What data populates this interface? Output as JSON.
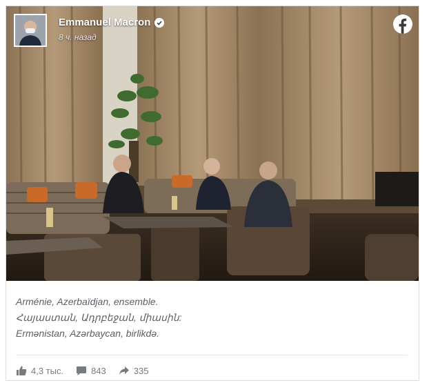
{
  "post": {
    "author": "Emmanuel Macron",
    "timestamp": "8 ч. назад",
    "caption_lines": [
      "Arménie, Azerbaïdjan, ensemble.",
      "Հայաստան, Ադրբեջան, միասին:",
      "Ermənistan, Azərbaycan, birlikdə."
    ],
    "stats": {
      "likes": "4,3 тыс.",
      "comments": "843",
      "shares": "335"
    }
  },
  "icons": {
    "verified": "verified-badge-icon",
    "platform": "facebook-logo-icon",
    "like": "thumbs-up-icon",
    "comment": "comment-icon",
    "share": "share-arrow-icon"
  },
  "colors": {
    "facebook_blue": "#1877f2",
    "caption_text": "#5b5f66",
    "stat_text": "#777b80"
  }
}
